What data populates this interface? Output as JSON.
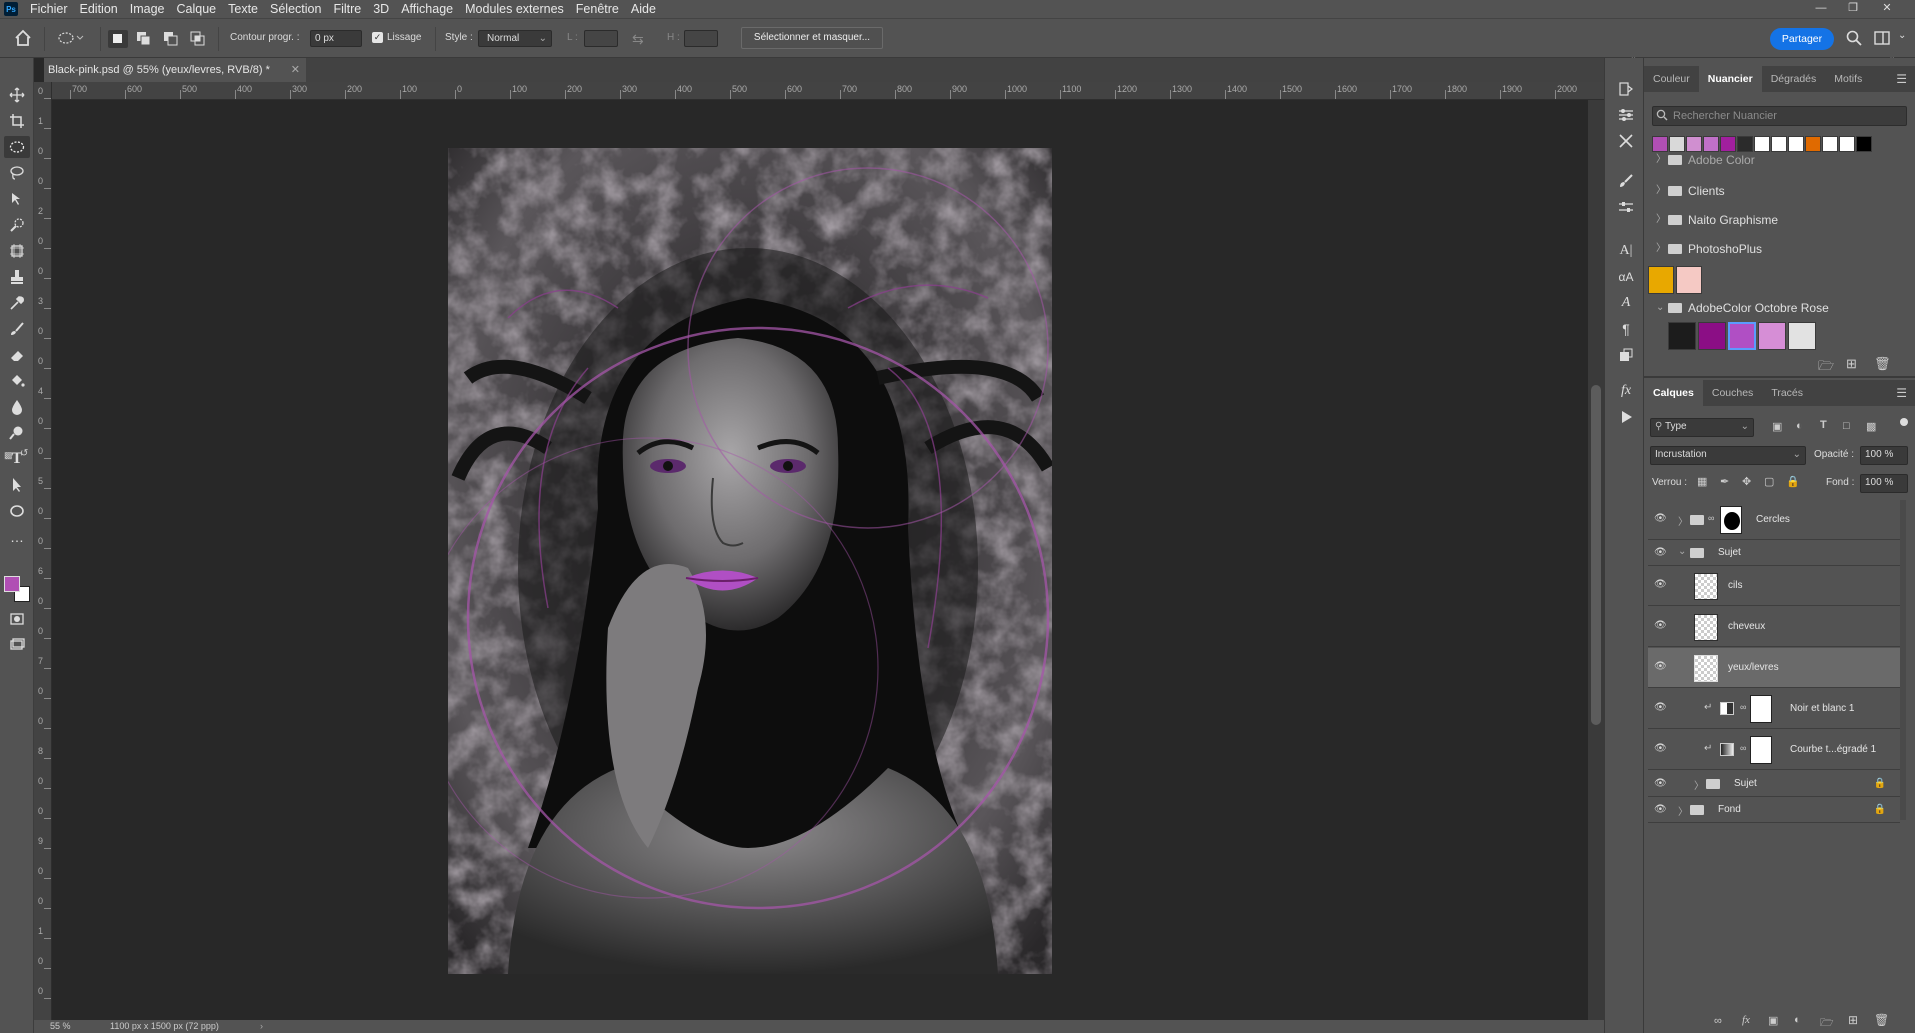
{
  "menubar": {
    "app_icon": "Ps",
    "items": [
      "Fichier",
      "Edition",
      "Image",
      "Calque",
      "Texte",
      "Sélection",
      "Filtre",
      "3D",
      "Affichage",
      "Modules externes",
      "Fenêtre",
      "Aide"
    ]
  },
  "options": {
    "feather_label": "Contour progr. :",
    "feather_value": "0 px",
    "antialias_label": "Lissage",
    "style_label": "Style :",
    "style_value": "Normal",
    "width_label": "L :",
    "height_label": "H :",
    "select_mask_button": "Sélectionner et masquer...",
    "share_button": "Partager"
  },
  "document": {
    "tab_title": "Black-pink.psd @ 55% (yeux/levres, RVB/8) *",
    "zoom": "55 %",
    "dimensions": "1100 px x 1500 px (72 ppp)"
  },
  "ruler_h": [
    "700",
    "600",
    "500",
    "400",
    "300",
    "200",
    "100",
    "0",
    "100",
    "200",
    "300",
    "400",
    "500",
    "600",
    "700",
    "800",
    "900",
    "1000",
    "1100",
    "1200",
    "1300",
    "1400",
    "1500",
    "1600",
    "1700",
    "1800",
    "1900",
    "2000"
  ],
  "ruler_v": [
    "0",
    "1",
    "0",
    "0",
    "2",
    "0",
    "0",
    "3",
    "0",
    "0",
    "4",
    "0",
    "0",
    "5",
    "0",
    "0",
    "6",
    "0",
    "0",
    "7",
    "0",
    "0",
    "8",
    "0",
    "0",
    "9",
    "0",
    "0",
    "1",
    "0",
    "0"
  ],
  "swatches_panel": {
    "tabs": [
      "Couleur",
      "Nuancier",
      "Dégradés",
      "Motifs"
    ],
    "active_tab": "Nuancier",
    "search_placeholder": "Rechercher Nuancier",
    "recent": [
      "#b04fb4",
      "#d9d9d9",
      "#d08fd0",
      "#c070c8",
      "#a11f9e",
      "#2b2b2b",
      "#ffffff",
      "#ffffff",
      "#ffffff",
      "#e06a00",
      "#ffffff",
      "#ffffff",
      "#000000"
    ],
    "partial_group": "Adobe Color",
    "groups": [
      "Clients",
      "Naito Graphisme",
      "PhotoshoPlus"
    ],
    "loose_swatches": [
      "#e8a800",
      "#f5c9c4"
    ],
    "open_group": "AdobeColor Octobre Rose",
    "open_group_swatches": [
      "#1c1c1c",
      "#8b0e85",
      "#b04fc4",
      "#d68ed6",
      "#e2e2e2"
    ]
  },
  "layers_panel": {
    "tabs": [
      "Calques",
      "Couches",
      "Tracés"
    ],
    "active_tab": "Calques",
    "filter_value": "Type",
    "blend_mode": "Incrustation",
    "opacity_label": "Opacité :",
    "opacity_value": "100 %",
    "lock_label": "Verrou :",
    "fill_label": "Fond :",
    "fill_value": "100 %",
    "layers": [
      {
        "name": "Cercles"
      },
      {
        "name": "Sujet"
      },
      {
        "name": "cils"
      },
      {
        "name": "cheveux"
      },
      {
        "name": "yeux/levres"
      },
      {
        "name": "Noir et blanc 1"
      },
      {
        "name": "Courbe t...égradé 1"
      },
      {
        "name": "Sujet"
      },
      {
        "name": "Fond"
      }
    ]
  },
  "colors": {
    "foreground": "#b04fb4",
    "background": "#ffffff",
    "accent": "#1473e6"
  }
}
